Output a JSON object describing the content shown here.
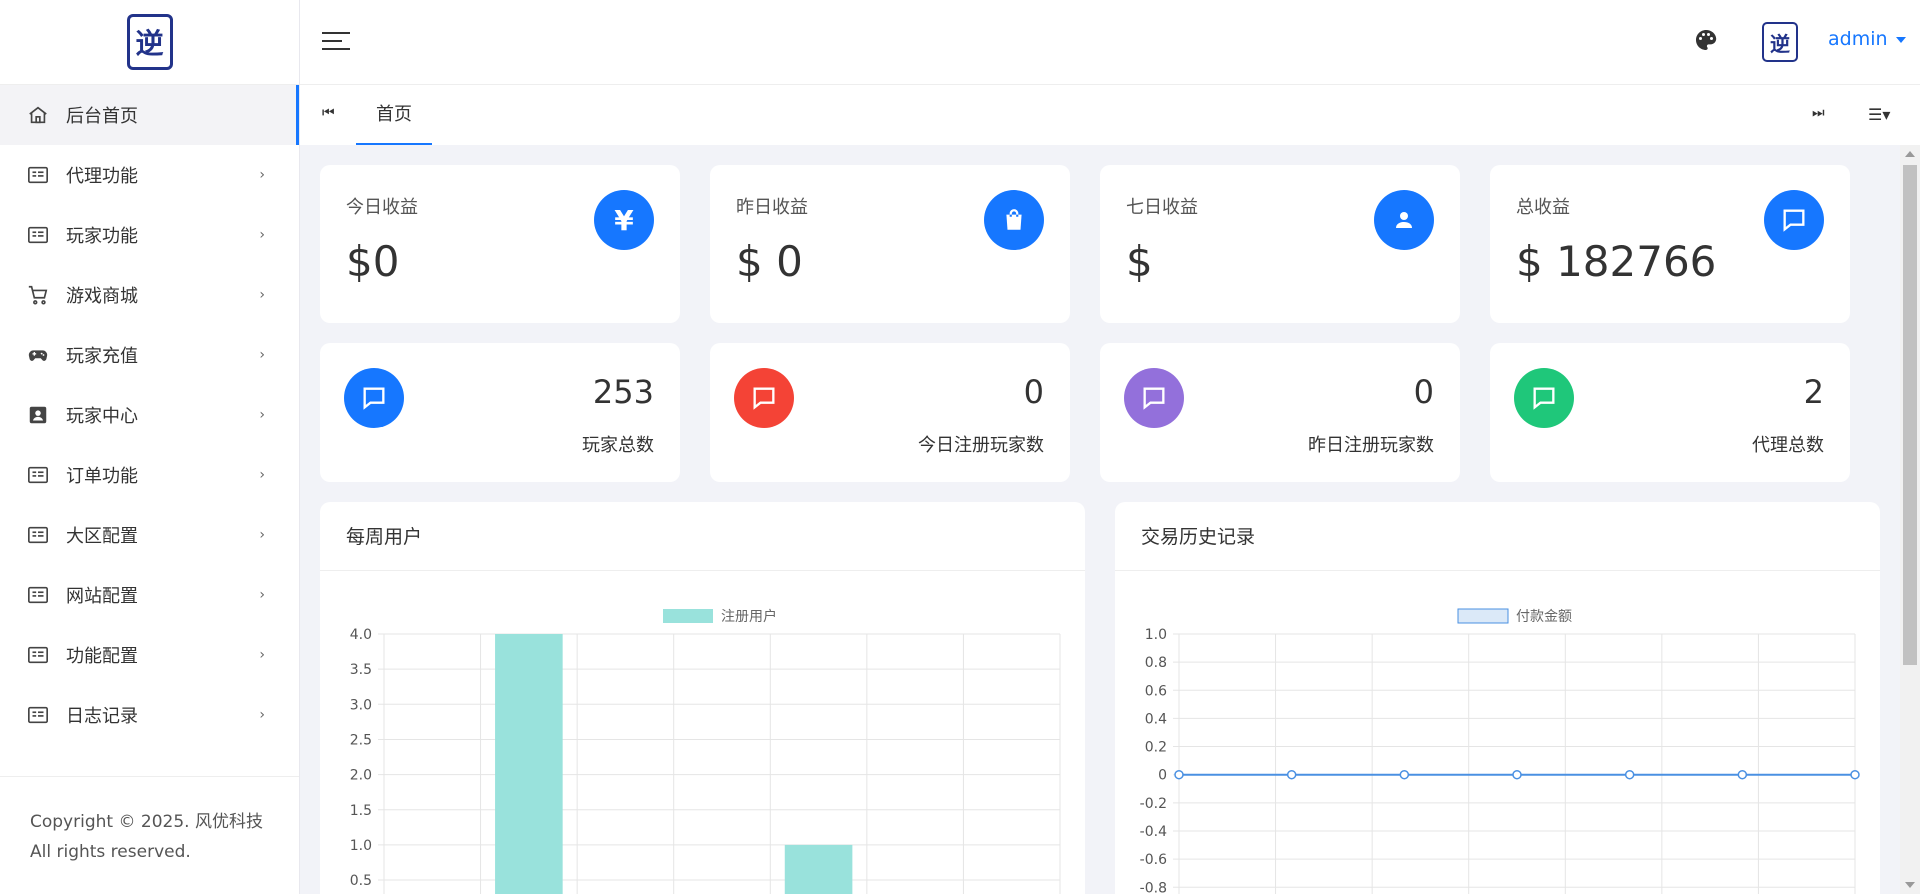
{
  "brand": {
    "logo_text": "逆",
    "accent": "#1677ff"
  },
  "sidebar": {
    "items": [
      {
        "label": "后台首页",
        "icon": "home-icon",
        "active": true
      },
      {
        "label": "代理功能",
        "icon": "card-list-icon"
      },
      {
        "label": "玩家功能",
        "icon": "card-list-icon"
      },
      {
        "label": "游戏商城",
        "icon": "cart-icon"
      },
      {
        "label": "玩家充值",
        "icon": "gamepad-icon"
      },
      {
        "label": "玩家中心",
        "icon": "user-badge-icon"
      },
      {
        "label": "订单功能",
        "icon": "card-list-icon"
      },
      {
        "label": "大区配置",
        "icon": "card-list-icon"
      },
      {
        "label": "网站配置",
        "icon": "card-list-icon"
      },
      {
        "label": "功能配置",
        "icon": "card-list-icon"
      },
      {
        "label": "日志记录",
        "icon": "card-list-icon"
      }
    ],
    "footer": "Copyright © 2025. 风优科技 All rights reserved."
  },
  "topbar": {
    "user": "admin"
  },
  "tabs": {
    "home": "首页"
  },
  "stats": [
    {
      "label": "今日收益",
      "value": "$0",
      "icon": "yen-icon",
      "color": "#1677ff"
    },
    {
      "label": "昨日收益",
      "value": "$ 0",
      "icon": "shopping-bag-icon",
      "color": "#1677ff"
    },
    {
      "label": "七日收益",
      "value": "$",
      "icon": "user-icon",
      "color": "#1677ff"
    },
    {
      "label": "总收益",
      "value": "$ 182766",
      "icon": "chat-icon",
      "color": "#1677ff"
    }
  ],
  "counts": [
    {
      "label": "玩家总数",
      "value": "253",
      "color": "#1677ff"
    },
    {
      "label": "今日注册玩家数",
      "value": "0",
      "color": "#f44336"
    },
    {
      "label": "昨日注册玩家数",
      "value": "0",
      "color": "#9370db"
    },
    {
      "label": "代理总数",
      "value": "2",
      "color": "#1fc77a"
    }
  ],
  "panels": {
    "weekly_title": "每周用户",
    "history_title": "交易历史记录"
  },
  "chart_data": [
    {
      "type": "bar",
      "legend": "注册用户",
      "color": "#99e2dc",
      "values": [
        0,
        4,
        0,
        0,
        1,
        0,
        0
      ],
      "yticks": [
        "4.0",
        "3.5",
        "3.0",
        "2.5",
        "2.0",
        "1.5",
        "1.0",
        "0.5"
      ],
      "ylim": [
        0,
        4
      ]
    },
    {
      "type": "line",
      "legend": "付款金额",
      "color": "#4a90e2",
      "values": [
        0,
        0,
        0,
        0,
        0,
        0,
        0
      ],
      "yticks": [
        "1.0",
        "0.8",
        "0.6",
        "0.4",
        "0.2",
        "0",
        "-0.2",
        "-0.4",
        "-0.6",
        "-0.8"
      ],
      "ylim": [
        -1,
        1
      ]
    }
  ]
}
